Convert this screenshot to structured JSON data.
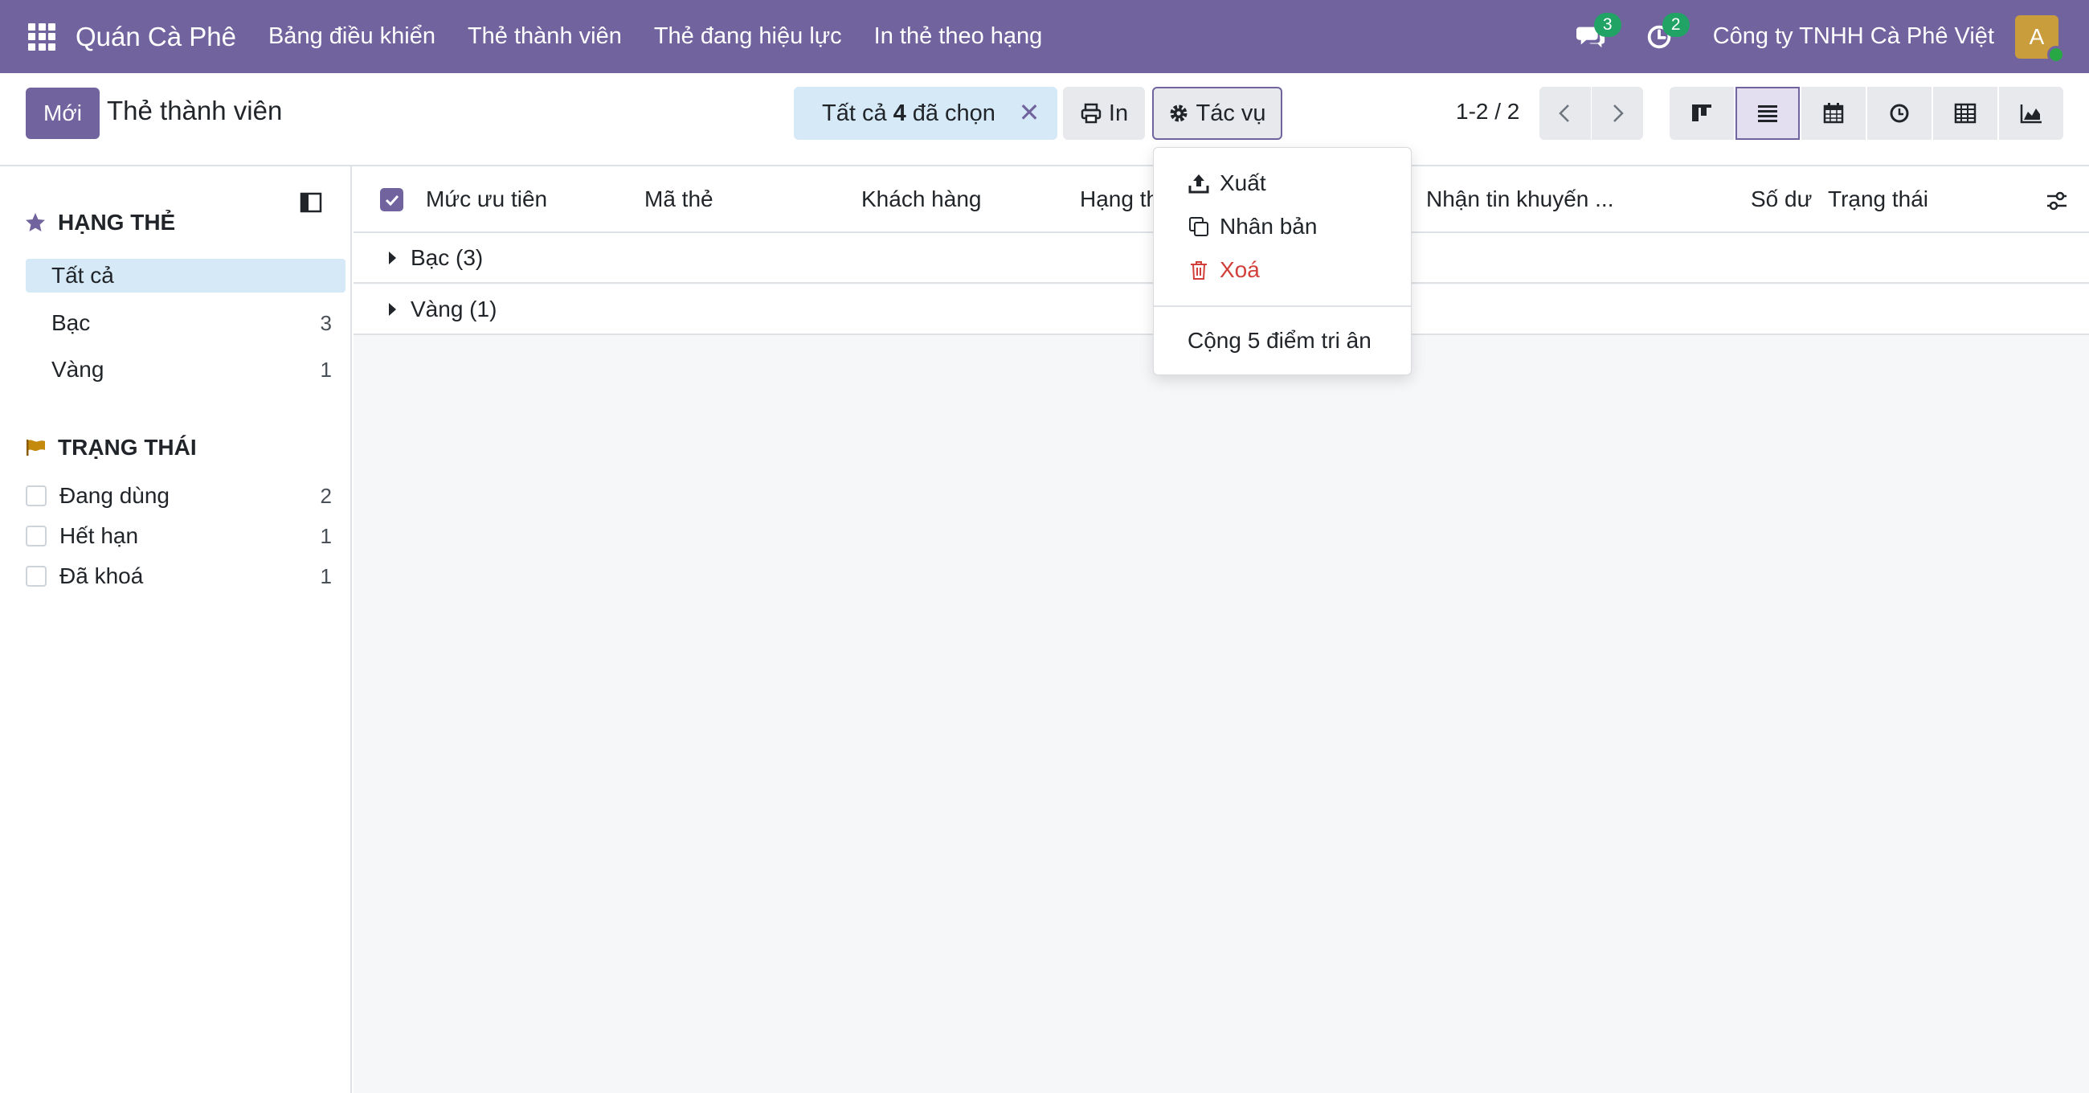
{
  "navbar": {
    "brand": "Quán Cà Phê",
    "menu": [
      "Bảng điều khiển",
      "Thẻ thành viên",
      "Thẻ đang hiệu lực",
      "In thẻ theo hạng"
    ],
    "messages_count": "3",
    "activities_count": "2",
    "company": "Công ty TNHH Cà Phê Việt",
    "avatar_initial": "A"
  },
  "control": {
    "new_label": "Mới",
    "title": "Thẻ thành viên",
    "selection": {
      "prefix": "Tất cả",
      "count": "4",
      "suffix": "đã chọn"
    },
    "print_label": "In",
    "action_label": "Tác vụ",
    "pager": "1-2 / 2",
    "views": [
      "kanban-icon",
      "list-icon",
      "calendar-icon",
      "activity-icon",
      "pivot-icon",
      "graph-icon"
    ],
    "active_view": "list-icon"
  },
  "sidebar": {
    "tier_heading": "HẠNG THẺ",
    "tier_items": [
      {
        "label": "Tất cả",
        "count": ""
      },
      {
        "label": "Bạc",
        "count": "3"
      },
      {
        "label": "Vàng",
        "count": "1"
      }
    ],
    "status_heading": "TRẠNG THÁI",
    "status_items": [
      {
        "label": "Đang dùng",
        "count": "2"
      },
      {
        "label": "Hết hạn",
        "count": "1"
      },
      {
        "label": "Đã khoá",
        "count": "1"
      }
    ]
  },
  "list": {
    "columns": [
      "Mức ưu tiên",
      "Mã thẻ",
      "Khách hàng",
      "Hạng th",
      "Nhận tin khuyến ...",
      "Số dư",
      "Trạng thái"
    ],
    "groups": [
      "Bạc (3)",
      "Vàng (1)"
    ]
  },
  "action_menu": {
    "export": "Xuất",
    "duplicate": "Nhân bản",
    "delete": "Xoá",
    "custom": "Cộng 5 điểm tri ân"
  },
  "colors": {
    "brand": "#71639e",
    "selection_bg": "#d6e9f7",
    "danger": "#d23f3a",
    "badge": "#21a366"
  }
}
